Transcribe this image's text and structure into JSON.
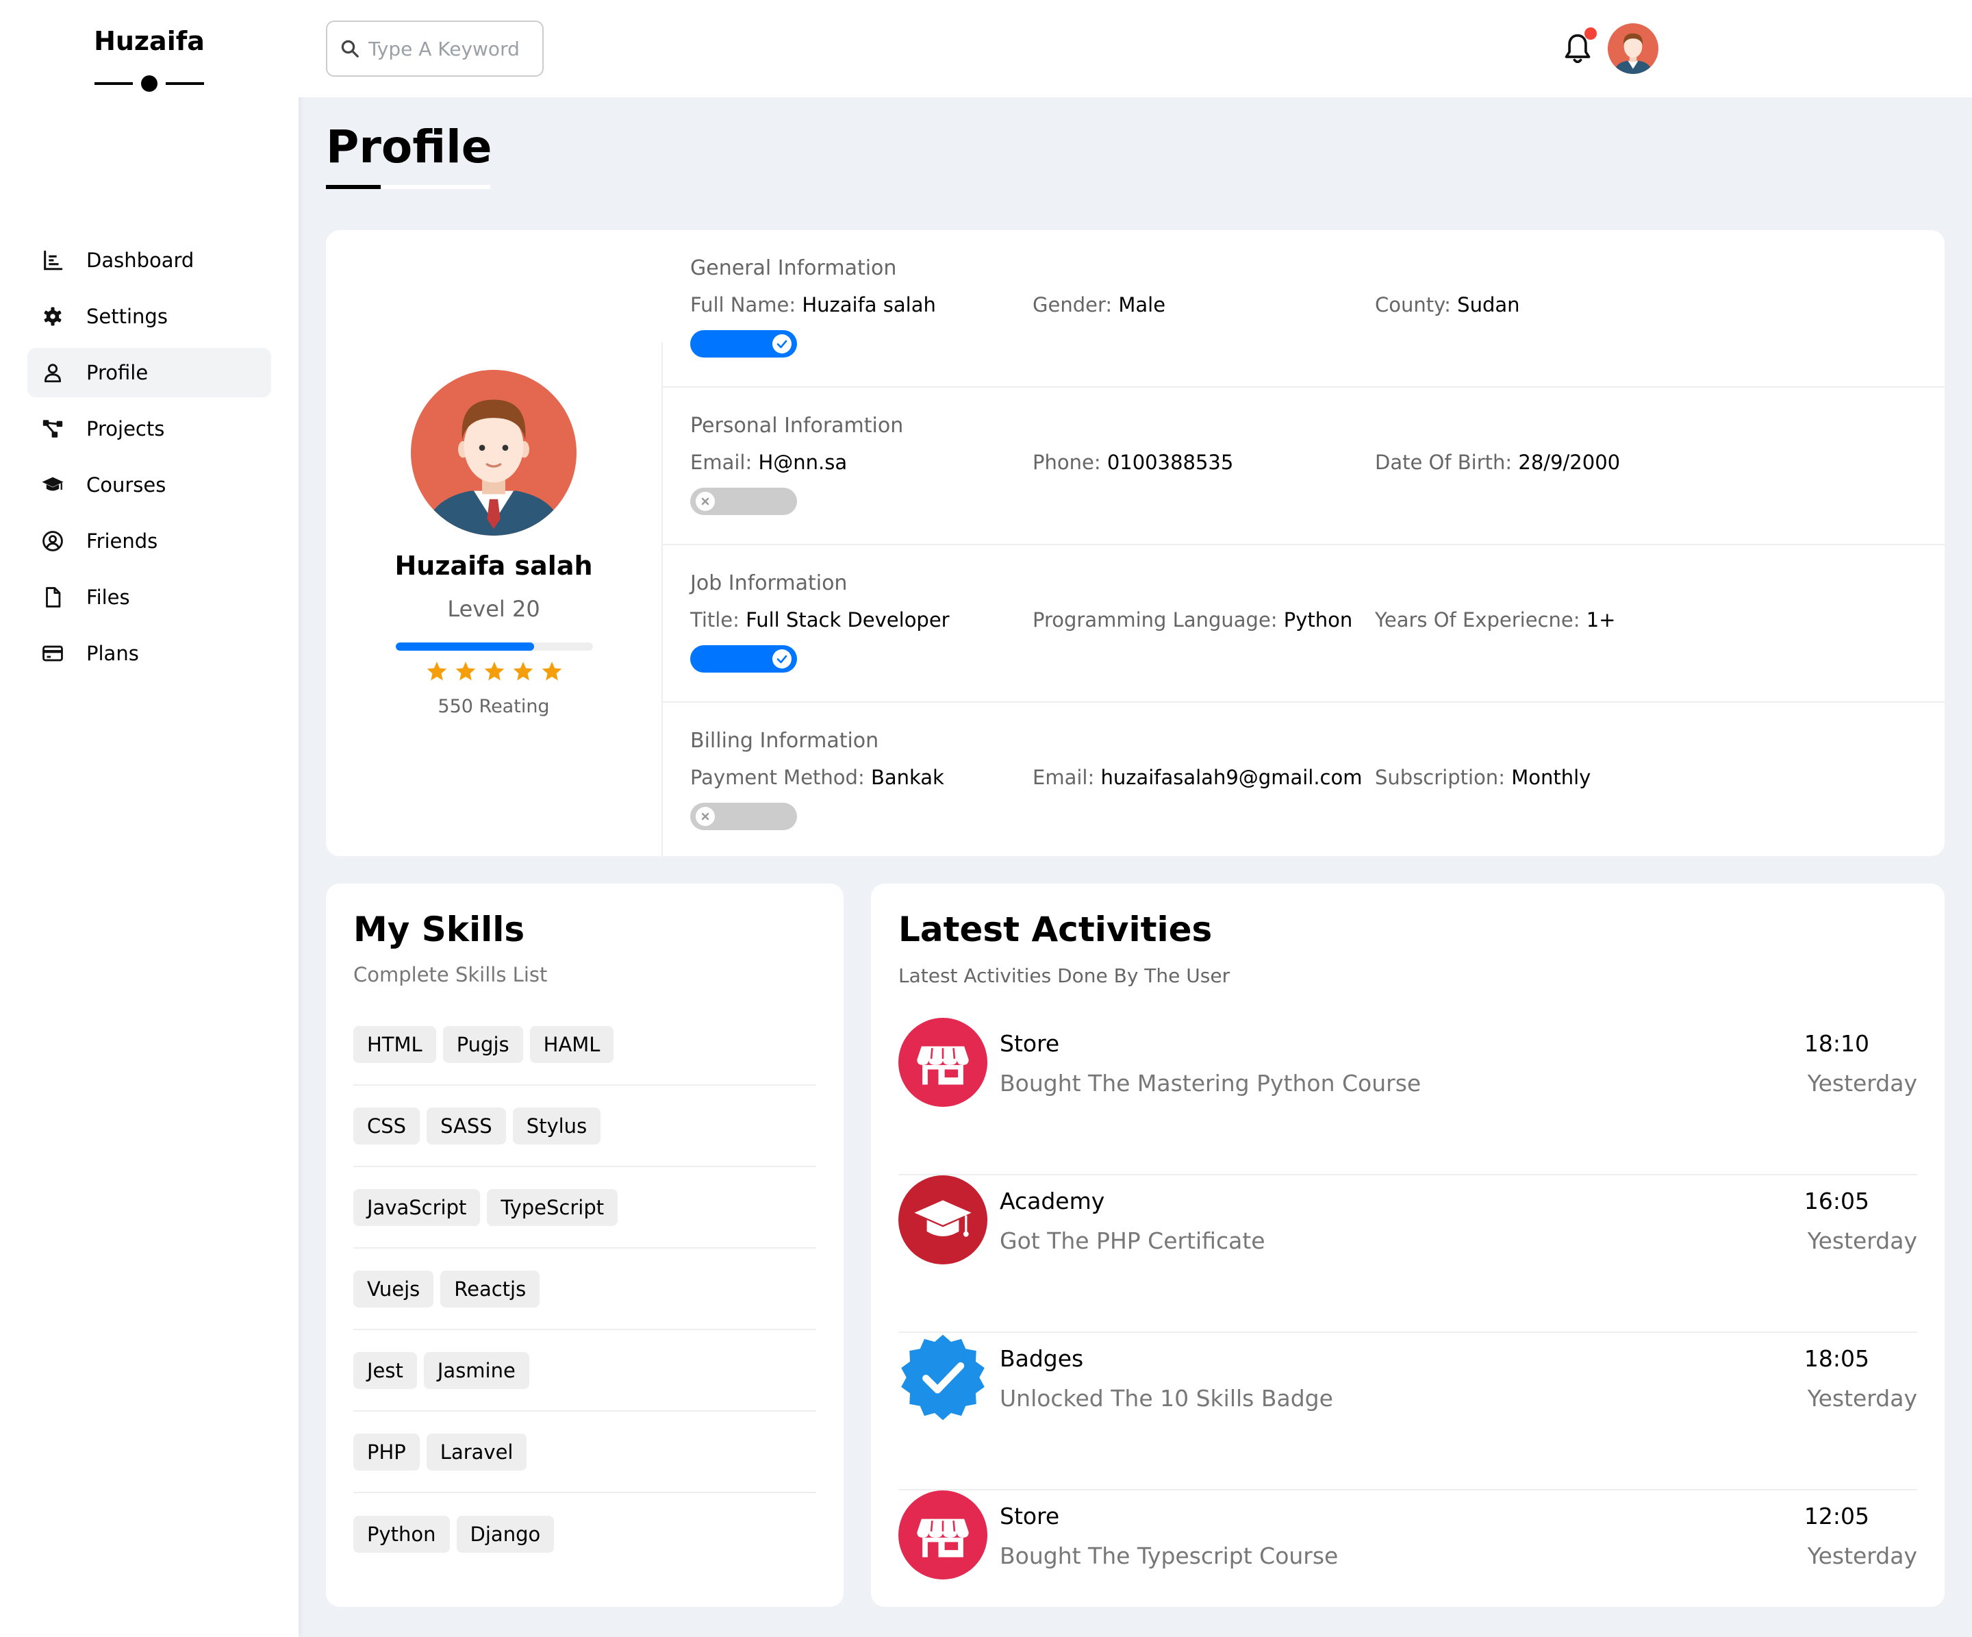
{
  "sidebar": {
    "logo": "Huzaifa",
    "items": [
      {
        "label": "Dashboard",
        "icon": "chart-icon",
        "active": false
      },
      {
        "label": "Settings",
        "icon": "gear-icon",
        "active": false
      },
      {
        "label": "Profile",
        "icon": "user-icon",
        "active": true
      },
      {
        "label": "Projects",
        "icon": "diagram-icon",
        "active": false
      },
      {
        "label": "Courses",
        "icon": "graduation-cap-icon",
        "active": false
      },
      {
        "label": "Friends",
        "icon": "user-circle-icon",
        "active": false
      },
      {
        "label": "Files",
        "icon": "file-icon",
        "active": false
      },
      {
        "label": "Plans",
        "icon": "credit-card-icon",
        "active": false
      }
    ]
  },
  "header": {
    "search_placeholder": "Type A Keyword",
    "has_notification": true
  },
  "page": {
    "title": "Profile"
  },
  "profile": {
    "name": "Huzaifa salah",
    "level": "Level 20",
    "level_progress_percent": 70,
    "stars": 5,
    "rating": "550 Reating"
  },
  "info_sections": [
    {
      "title": "General Information",
      "fields": [
        {
          "label": "Full Name:",
          "value": "Huzaifa salah"
        },
        {
          "label": "Gender:",
          "value": "Male"
        },
        {
          "label": "County:",
          "value": "Sudan"
        }
      ],
      "toggle_on": true
    },
    {
      "title": "Personal Inforamtion",
      "fields": [
        {
          "label": "Email:",
          "value": "H@nn.sa"
        },
        {
          "label": "Phone:",
          "value": "0100388535"
        },
        {
          "label": "Date Of Birth:",
          "value": "28/9/2000"
        }
      ],
      "toggle_on": false
    },
    {
      "title": "Job Information",
      "fields": [
        {
          "label": "Title:",
          "value": "Full Stack Developer"
        },
        {
          "label": "Programming Language:",
          "value": "Python"
        },
        {
          "label": "Years Of Experiecne:",
          "value": "1+"
        }
      ],
      "toggle_on": true
    },
    {
      "title": "Billing Information",
      "fields": [
        {
          "label": "Payment Method:",
          "value": "Bankak"
        },
        {
          "label": "Email:",
          "value": "huzaifasalah9@gmail.com"
        },
        {
          "label": "Subscription:",
          "value": "Monthly"
        }
      ],
      "toggle_on": false
    }
  ],
  "skills": {
    "title": "My Skills",
    "subtitle": "Complete Skills List",
    "rows": [
      [
        "HTML",
        "Pugjs",
        "HAML"
      ],
      [
        "CSS",
        "SASS",
        "Stylus"
      ],
      [
        "JavaScript",
        "TypeScript"
      ],
      [
        "Vuejs",
        "Reactjs"
      ],
      [
        "Jest",
        "Jasmine"
      ],
      [
        "PHP",
        "Laravel"
      ],
      [
        "Python",
        "Django"
      ]
    ]
  },
  "activities": {
    "title": "Latest Activities",
    "subtitle": "Latest Activities Done By The User",
    "items": [
      {
        "icon": "store-icon",
        "title": "Store",
        "desc": "Bought The Mastering Python Course",
        "time": "18:10",
        "day": "Yesterday"
      },
      {
        "icon": "academy-icon",
        "title": "Academy",
        "desc": "Got The PHP Certificate",
        "time": "16:05",
        "day": "Yesterday"
      },
      {
        "icon": "badge-icon",
        "title": "Badges",
        "desc": "Unlocked The 10 Skills Badge",
        "time": "18:05",
        "day": "Yesterday"
      },
      {
        "icon": "store-icon",
        "title": "Store",
        "desc": "Bought The Typescript Course",
        "time": "12:05",
        "day": "Yesterday"
      }
    ]
  },
  "colors": {
    "accent": "#0075ff",
    "store_red": "#e3294f",
    "academy_red": "#c4202f",
    "badge_blue": "#1c8fe8",
    "star": "#f59e0b",
    "avatar_bg": "#e4684f"
  }
}
